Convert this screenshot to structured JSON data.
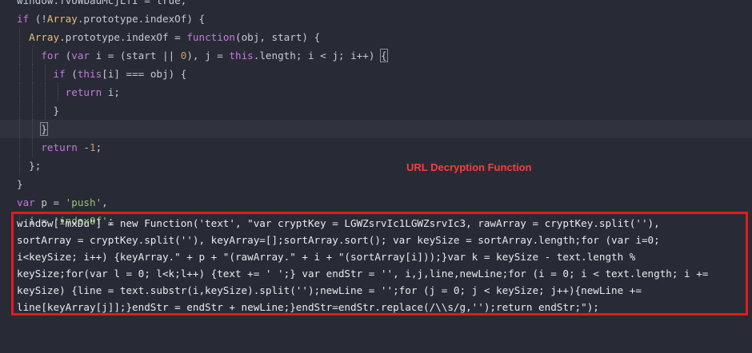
{
  "annotation": {
    "label": "URL Decryption Function",
    "color": "#ff3b3b"
  },
  "code_lines": [
    "window.fvUWbauMcjLfI = true;",
    "if (!Array.prototype.indexOf) {",
    "  Array.prototype.indexOf = function(obj, start) {",
    "    for (var i = (start || 0), j = this.length; i < j; i++) {",
    "      if (this[i] === obj) {",
    "        return i;",
    "      }",
    "    }",
    "    return -1;",
    "  };",
    "}",
    "var p = 'push',",
    "  i = 'indexOf';"
  ],
  "highlighted_code": [
    "window[\"mxDu\"] = new Function('text', \"var cryptKey = LGWZsrvIc1LGWZsrvIc3, rawArray = cryptKey.split(''),",
    "sortArray = cryptKey.split(''), keyArray=[];sortArray.sort(); var keySize = sortArray.length;for (var i=0;",
    "i<keySize; i++) {keyArray.\" + p + \"(rawArray.\" + i + \"(sortArray[i]));}var k = keySize - text.length %",
    "keySize;for(var l = 0; l<k;l++) {text += ' ';} var endStr = '', i,j,line,newLine;for (i = 0; i < text.length; i +=",
    "keySize) {line = text.substr(i,keySize).split('');newLine = '';for (j = 0; j < keySize; j++){newLine +=",
    "line[keyArray[j]];}endStr = endStr + newLine;}endStr=endStr.replace(/\\\\s/g,'');return endStr;\");"
  ],
  "colors": {
    "background": "#282b35",
    "box_border": "#e31b1b",
    "keyword": "#c678dd",
    "string": "#98c379",
    "number": "#d19a66"
  }
}
